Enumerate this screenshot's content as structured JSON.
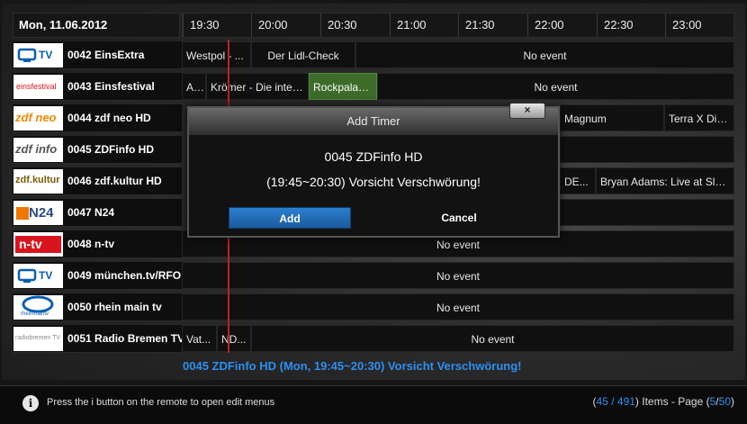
{
  "header": {
    "date": "Mon, 11.06.2012",
    "times": [
      "19:30",
      "20:00",
      "20:30",
      "21:00",
      "21:30",
      "22:00",
      "22:30",
      "23:00"
    ]
  },
  "channels": [
    {
      "name": "0042 EinsExtra",
      "logo_text": "TV",
      "events": [
        "Westpol - ...",
        "Der Lidl-Check",
        "No event"
      ]
    },
    {
      "name": "0043 Einsfestival",
      "logo_text": "einsfestival",
      "events": [
        "A...",
        "Krömer - Die inter...",
        "Rockpalas...",
        "No event"
      ]
    },
    {
      "name": "0044 zdf neo HD",
      "logo_text": "zdf neo",
      "events": [
        "Magnum",
        "Terra X Die..."
      ]
    },
    {
      "name": "0045 ZDFinfo HD",
      "logo_text": "zdf info",
      "events": []
    },
    {
      "name": "0046 zdf.kultur HD",
      "logo_text": "zdf.kultur",
      "events": [
        "DE...",
        "Bryan Adams: Live at Sla..."
      ]
    },
    {
      "name": "0047 N24",
      "logo_text": "N24",
      "events": []
    },
    {
      "name": "0048 n-tv",
      "logo_text": "n-tv",
      "events": [
        "No event"
      ]
    },
    {
      "name": "0049 münchen.tv/RFO",
      "logo_text": "TV",
      "events": [
        "No event"
      ]
    },
    {
      "name": "0050 rhein main tv",
      "logo_text": "rheinmaintv",
      "events": [
        "No event"
      ]
    },
    {
      "name": "0051 Radio Bremen TV",
      "logo_text": "radiobremen TV",
      "events": [
        "Vat...",
        "ND...",
        "No event"
      ]
    }
  ],
  "info_line": "0045 ZDFinfo HD (Mon, 19:45~20:30) Vorsicht Verschwörung!",
  "footer": {
    "hint": "Press the i button on the remote to open edit menus",
    "info_icon": "i",
    "page": {
      "open": "(",
      "current_item": "45",
      "sep": " / ",
      "total_items": "491",
      "mid": ") Items - Page (",
      "current_page": "5",
      "page_sep": "/",
      "total_pages": "50",
      "close": ")"
    }
  },
  "dialog": {
    "title": "Add Timer",
    "close": "×",
    "channel": "0045 ZDFinfo HD",
    "event": "(19:45~20:30) Vorsicht Verschwörung!",
    "add": "Add",
    "cancel": "Cancel"
  },
  "colors": {
    "accent": "#2d8ff0",
    "highlight_event": "#3c6b2a",
    "now_line": "#c81e1e"
  }
}
